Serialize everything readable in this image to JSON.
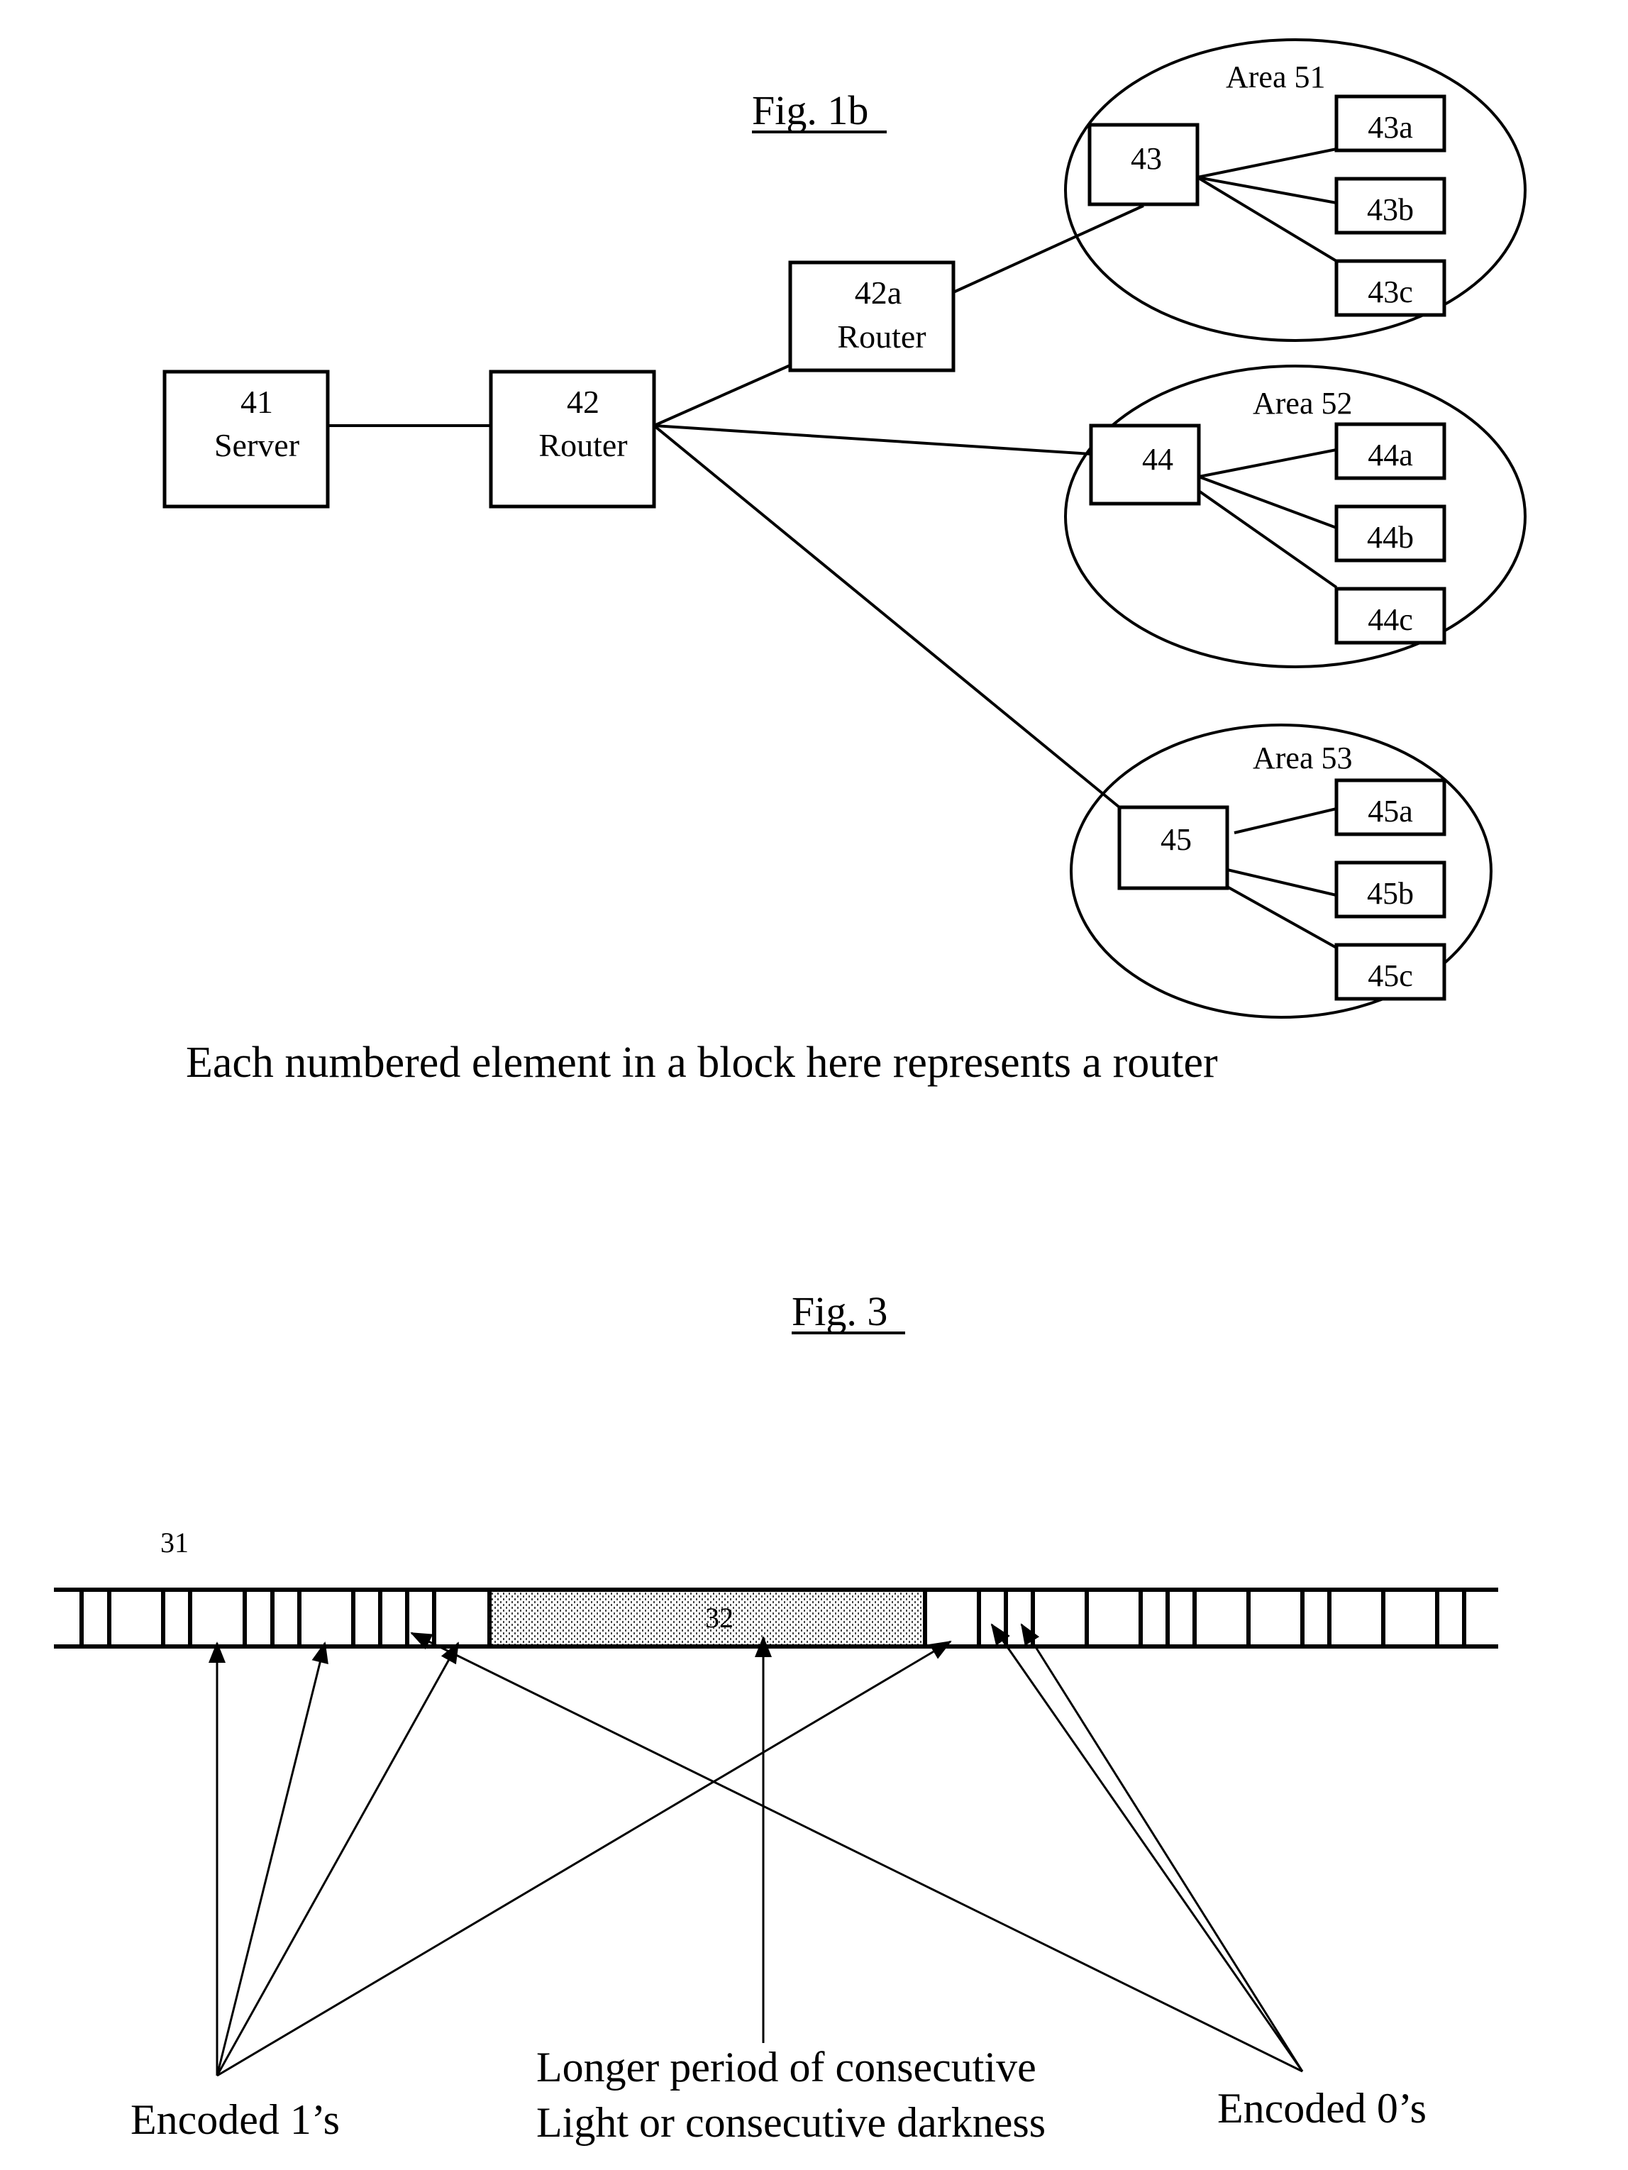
{
  "fig1b": {
    "title": "Fig. 1b",
    "caption": "Each numbered element in a block here represents a router",
    "nodes": {
      "server": {
        "id": "41",
        "label": "Server"
      },
      "router42": {
        "id": "42",
        "label": "Router"
      },
      "router42a": {
        "id": "42a",
        "label": "Router"
      }
    },
    "areas": [
      {
        "label": "Area 51",
        "hub": "43",
        "leaves": [
          "43a",
          "43b",
          "43c"
        ]
      },
      {
        "label": "Area 52",
        "hub": "44",
        "leaves": [
          "44a",
          "44b",
          "44c"
        ]
      },
      {
        "label": "Area 53",
        "hub": "45",
        "leaves": [
          "45a",
          "45b",
          "45c"
        ]
      }
    ]
  },
  "fig3": {
    "title": "Fig. 3",
    "signal_label": "31",
    "gap_label": "32",
    "labels": {
      "ones": "Encoded 1’s",
      "gap_line1": "Longer period of consecutive",
      "gap_line2": "Light or consecutive darkness",
      "zeros": "Encoded 0’s"
    }
  }
}
